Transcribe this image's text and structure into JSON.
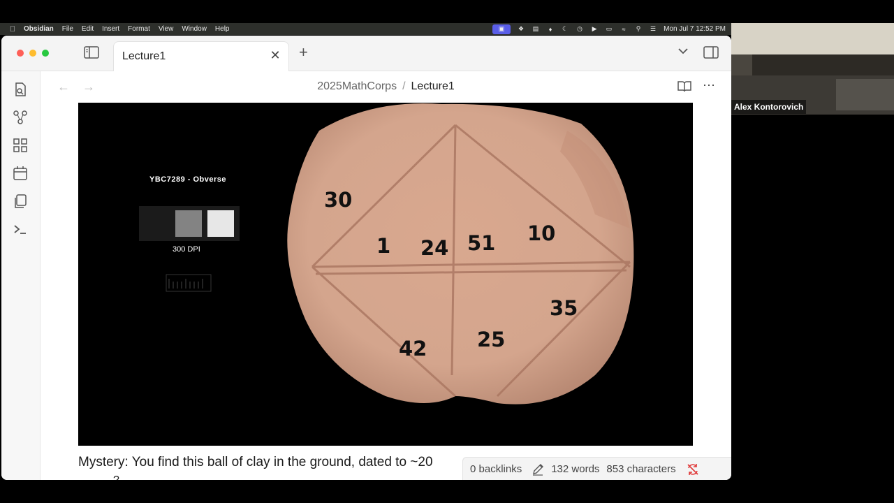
{
  "menubar": {
    "app_name": "Obsidian",
    "menus": [
      "File",
      "Edit",
      "Insert",
      "Format",
      "View",
      "Window",
      "Help"
    ],
    "clock": "Mon Jul 7  12:52 PM"
  },
  "tabs": {
    "active_title": "Lecture1"
  },
  "breadcrumb": {
    "folder": "2025MathCorps",
    "separator": "/",
    "file": "Lecture1"
  },
  "image": {
    "title": "YBC7289 - Obverse",
    "dpi_label": "300 DPI",
    "numbers": [
      "30",
      "1",
      "24",
      "51",
      "10",
      "35",
      "25",
      "42"
    ]
  },
  "body": {
    "line1": "Mystery: You find this ball of clay in the ground, dated to ~20",
    "line2": "?"
  },
  "status": {
    "backlinks": "0 backlinks",
    "words": "132 words",
    "characters": "853 characters"
  },
  "video": {
    "participant": "Alex Kontorovich"
  },
  "colors": {
    "accent": "#5a5ee8",
    "sync_error": "#e03a3a"
  }
}
